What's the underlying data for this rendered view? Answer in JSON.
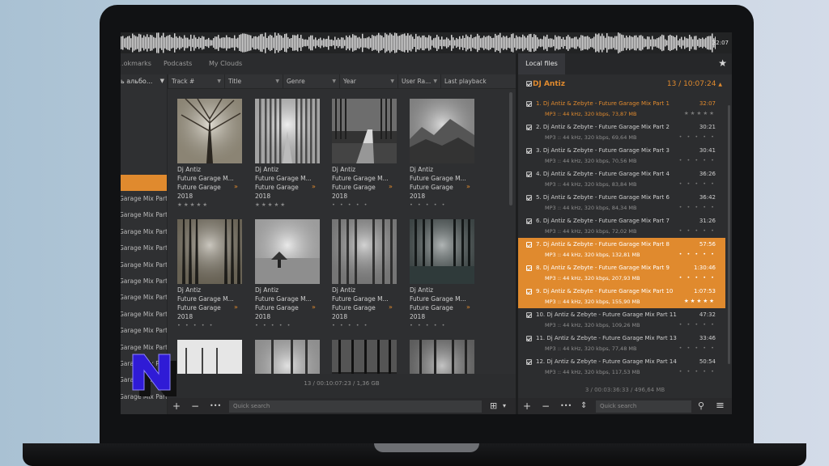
{
  "waveform": {
    "time": "32:07"
  },
  "tabs": [
    "...okmarks",
    "Podcasts",
    "My Clouds"
  ],
  "sidebar": {
    "header": "ь альбо...",
    "items": [
      "Garage Mix Part",
      "Garage Mix Part",
      "Garage Mix Part",
      "Garage Mix Part",
      "Garage Mix Part",
      "Garage Mix Part",
      "Garage Mix Part",
      "Garage Mix Part",
      "Garage Mix Part",
      "Garage Mix Part",
      "Garage Mix Part",
      "Garage Mix Part",
      "Garage Mix Part"
    ]
  },
  "columns": [
    "Track #",
    "Title",
    "Genre",
    "Year",
    "User Ra...",
    "Last playback"
  ],
  "grid": {
    "tiles": [
      {
        "artist": "Dj Antiz",
        "album": "Future Garage M...",
        "genre": "Future Garage",
        "year": "2018",
        "stars": "★★★★★"
      },
      {
        "artist": "Dj Antiz",
        "album": "Future Garage M...",
        "genre": "Future Garage",
        "year": "2018",
        "stars": "★★★★★"
      },
      {
        "artist": "Dj Antiz",
        "album": "Future Garage M...",
        "genre": "Future Garage",
        "year": "2018",
        "stars": "• • • • •"
      },
      {
        "artist": "Dj Antiz",
        "album": "Future Garage M...",
        "genre": "Future Garage",
        "year": "2018",
        "stars": "• • • • •"
      },
      {
        "artist": "Dj Antiz",
        "album": "Future Garage M...",
        "genre": "Future Garage",
        "year": "2018",
        "stars": "• • • • •"
      },
      {
        "artist": "Dj Antiz",
        "album": "Future Garage M...",
        "genre": "Future Garage",
        "year": "2018",
        "stars": "• • • • •"
      },
      {
        "artist": "Dj Antiz",
        "album": "Future Garage M...",
        "genre": "Future Garage",
        "year": "2018",
        "stars": "• • • • •"
      },
      {
        "artist": "Dj Antiz",
        "album": "Future Garage M...",
        "genre": "Future Garage",
        "year": "2018",
        "stars": "• • • • •"
      }
    ],
    "mark": "»"
  },
  "left_status": "13 / 00:10:07:23 / 1,36 GB",
  "left_toolbar": {
    "add": "+",
    "remove": "−",
    "more": "•••",
    "search_placeholder": "Quick search",
    "grid": "⊞",
    "caret": "▾"
  },
  "right": {
    "tab": "Local files",
    "star": "★",
    "group": {
      "title": "DJ Antiz",
      "meta": "13 / 10:07:24",
      "caret": "▲"
    },
    "tracks": [
      {
        "title": "1. Dj Antiz & Zebyte - Future Garage Mix Part 1",
        "meta": "MP3 :: 44 kHz, 320 kbps, 73,87 MB",
        "dur": "32:07",
        "stars": "★★★★★"
      },
      {
        "title": "2. Dj Antiz & Zebyte - Future Garage Mix Part 2",
        "meta": "MP3 :: 44 kHz, 320 kbps, 69,64 MB",
        "dur": "30:21",
        "stars": "• • • • •"
      },
      {
        "title": "3. Dj Antiz & Zebyte - Future Garage Mix Part 3",
        "meta": "MP3 :: 44 kHz, 320 kbps, 70,56 MB",
        "dur": "30:41",
        "stars": "• • • • •"
      },
      {
        "title": "4. Dj Antiz & Zebyte - Future Garage Mix Part 4",
        "meta": "MP3 :: 44 kHz, 320 kbps, 83,84 MB",
        "dur": "36:26",
        "stars": "• • • • •"
      },
      {
        "title": "5. Dj Antiz & Zebyte - Future Garage Mix Part 6",
        "meta": "MP3 :: 44 kHz, 320 kbps, 84,34 MB",
        "dur": "36:42",
        "stars": "• • • • •"
      },
      {
        "title": "6. Dj Antiz & Zebyte - Future Garage Mix Part 7",
        "meta": "MP3 :: 44 kHz, 320 kbps, 72,02 MB",
        "dur": "31:26",
        "stars": "• • • • •"
      },
      {
        "title": "7. Dj Antiz & Zebyte - Future Garage Mix Part 8",
        "meta": "MP3 :: 44 kHz, 320 kbps, 132,81 MB",
        "dur": "57:56",
        "stars": "• • • • •"
      },
      {
        "title": "8. Dj Antiz & Zebyte - Future Garage Mix Part 9",
        "meta": "MP3 :: 44 kHz, 320 kbps, 207,93 MB",
        "dur": "1:30:46",
        "stars": "• • • • •"
      },
      {
        "title": "9. Dj Antiz & Zebyte - Future Garage Mix Part 10",
        "meta": "MP3 :: 44 kHz, 320 kbps, 155,90 MB",
        "dur": "1:07:53",
        "stars": "★★★★★"
      },
      {
        "title": "10. Dj Antiz & Zebyte - Future Garage Mix Part 11",
        "meta": "MP3 :: 44 kHz, 320 kbps, 109,26 MB",
        "dur": "47:32",
        "stars": "• • • • •"
      },
      {
        "title": "11. Dj Antiz & Zebyte - Future Garage Mix Part 13",
        "meta": "MP3 :: 44 kHz, 320 kbps, 77,48 MB",
        "dur": "33:46",
        "stars": "• • • • •"
      },
      {
        "title": "12. Dj Antiz & Zebyte - Future Garage Mix Part 14",
        "meta": "MP3 :: 44 kHz, 320 kbps, 117,53 MB",
        "dur": "50:54",
        "stars": "• • • • •"
      }
    ],
    "status": "3 / 00:03:36:33 / 496,64 MB",
    "toolbar": {
      "add": "+",
      "remove": "−",
      "more": "•••",
      "sort": "⇕",
      "search_placeholder": "Quick search",
      "search_icon": "⚲",
      "menu": "≡"
    }
  },
  "colors": {
    "accent": "#e08a2e",
    "panel": "#2c2d2f",
    "logo_fill": "#2f1bd6"
  },
  "logo": {
    "letter": "N"
  }
}
